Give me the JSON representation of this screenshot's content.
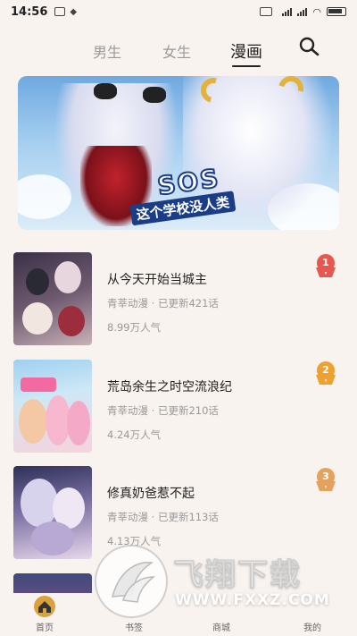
{
  "status_bar": {
    "time": "14:56",
    "right_text": "5G 4G",
    "battery": "battery-icon"
  },
  "tabs": [
    {
      "label": "男生",
      "active": false
    },
    {
      "label": "女生",
      "active": false
    },
    {
      "label": "漫画",
      "active": true
    }
  ],
  "search": {
    "icon": "search-icon"
  },
  "banner": {
    "title": "SOS",
    "subtitle": "这个学校没人类"
  },
  "comics": [
    {
      "rank": "1",
      "title": "从今天开始当城主",
      "meta": "青莘动漫 · 已更新421话",
      "popularity": "8.99万人气",
      "badge_color": "#e8574f"
    },
    {
      "rank": "2",
      "title": "荒岛余生之时空流浪纪",
      "meta": "青莘动漫 · 已更新210话",
      "popularity": "4.24万人气",
      "badge_color": "#f0a02c"
    },
    {
      "rank": "3",
      "title": "修真奶爸惹不起",
      "meta": "青莘动漫 · 已更新113话",
      "popularity": "4.13万人气",
      "badge_color": "#e5a15e"
    }
  ],
  "watermark": {
    "main": "飞翔下载",
    "sub": "WWW.FXXZ.COM"
  },
  "bottom_nav": [
    {
      "label": "首页",
      "icon": "home-icon"
    },
    {
      "label": "书签",
      "icon": "bookmark-icon"
    },
    {
      "label": "商城",
      "icon": "store-icon"
    },
    {
      "label": "我的",
      "icon": "profile-icon"
    }
  ]
}
